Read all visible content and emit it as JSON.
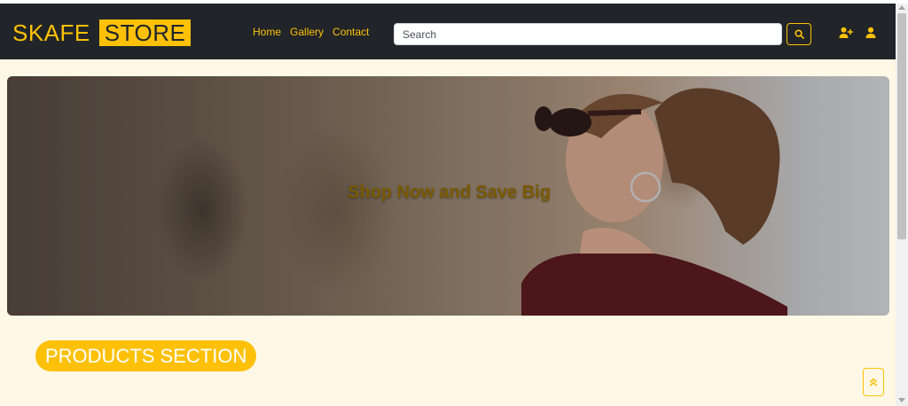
{
  "brand": {
    "name": "SKAFE",
    "highlight": "STORE"
  },
  "nav": {
    "links": [
      "Home",
      "Gallery",
      "Contact"
    ]
  },
  "search": {
    "placeholder": "Search",
    "button_icon": "search-icon"
  },
  "header_icons": [
    "user-plus-icon",
    "user-icon"
  ],
  "hero": {
    "caption": "Shop Now and Save Big"
  },
  "products": {
    "heading": "PRODUCTS SECTION"
  },
  "back_to_top": {
    "icon": "double-chevron-up-icon"
  },
  "colors": {
    "accent": "#ffc107",
    "navbar": "#212529",
    "page_bg": "#fff8e6"
  }
}
